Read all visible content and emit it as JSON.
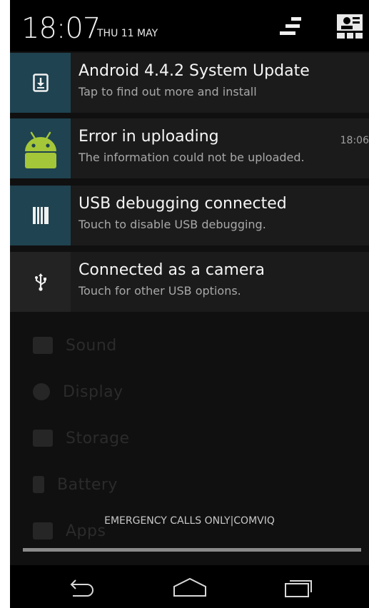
{
  "status": {
    "time": "18:07",
    "date": "THU 11 MAY"
  },
  "header_icons": {
    "settings_toggle": "settings-toggle-icon",
    "quick_settings": "quick-settings-icon"
  },
  "notifications": [
    {
      "title": "Android 4.4.2 System Update",
      "subtitle": "Tap to find out more and install",
      "time": "",
      "icon": "system-update-icon",
      "icon_bg": "#1f4350"
    },
    {
      "title": "Error in uploading",
      "subtitle": "The information could not be uploaded.",
      "time": "18:06",
      "icon": "android-icon",
      "icon_bg": "#1f4350"
    },
    {
      "title": "USB debugging connected",
      "subtitle": "Touch to disable USB debugging.",
      "time": "",
      "icon": "usb-debugging-icon",
      "icon_bg": "#1f4350"
    },
    {
      "title": "Connected as a camera",
      "subtitle": "Touch for other USB options.",
      "time": "",
      "icon": "usb-icon",
      "icon_bg": "#232323"
    }
  ],
  "background_settings": [
    {
      "label": "Sound",
      "icon": "sound-icon"
    },
    {
      "label": "Display",
      "icon": "display-icon"
    },
    {
      "label": "Storage",
      "icon": "storage-icon"
    },
    {
      "label": "Battery",
      "icon": "battery-icon"
    },
    {
      "label": "Apps",
      "icon": "apps-icon"
    }
  ],
  "carrier": "EMERGENCY CALLS ONLY|COMVIQ",
  "navbar": {
    "back": "back-icon",
    "home": "home-icon",
    "recents": "recents-icon"
  },
  "colors": {
    "accent_icon_bg": "#1f4350",
    "android_green": "#a4c639"
  }
}
